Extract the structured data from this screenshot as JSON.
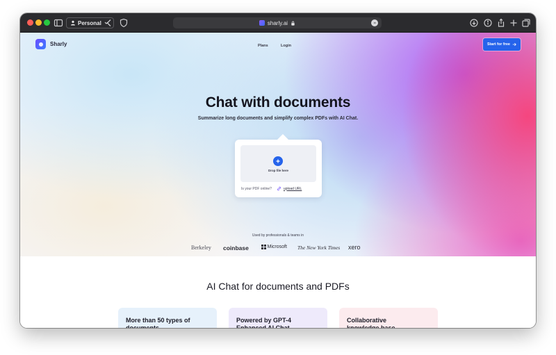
{
  "browser": {
    "profile_label": "Personal",
    "url": "sharly.ai",
    "more_symbol": "•••"
  },
  "site": {
    "logo_text": "Sharly",
    "nav": {
      "plans": "Plans",
      "login": "Login"
    },
    "cta_label": "Start for free"
  },
  "hero": {
    "title": "Chat with documents",
    "subtitle": "Summarize long documents and simplify complex PDFs with AI Chat.",
    "drop_text": "Drop file here",
    "online_prompt": "Is your PDF online?",
    "upload_url_label": "upload URL"
  },
  "trust": {
    "used_by": "Used by professionals & teams in",
    "logos": {
      "berkeley": "Berkeley",
      "coinbase": "coinbase",
      "microsoft": "Microsoft",
      "nyt": "The New York Times",
      "xero": "xero"
    }
  },
  "section": {
    "title": "AI Chat for documents and PDFs"
  },
  "features": [
    {
      "title": "More than 50 types of documents"
    },
    {
      "title": "Powered by GPT-4 Enhanced AI Chat"
    },
    {
      "title": "Collaborative knowledge base"
    }
  ],
  "colors": {
    "accent": "#2563eb",
    "titlebar": "#2b2b2e",
    "feature_1_bg": "#e6f1fb",
    "feature_2_bg": "#eeeafb",
    "feature_3_bg": "#fcebee"
  },
  "icons": {
    "window_controls": [
      "close-icon",
      "minimize-icon",
      "zoom-icon"
    ],
    "toolbar": [
      "sidebar-icon",
      "person-icon",
      "back-chevron-icon",
      "shield-icon",
      "lock-icon",
      "download-icon",
      "info-icon",
      "share-icon",
      "new-tab-icon",
      "tabs-icon"
    ],
    "page": [
      "plus-icon",
      "link-icon",
      "arrow-right-icon"
    ]
  }
}
